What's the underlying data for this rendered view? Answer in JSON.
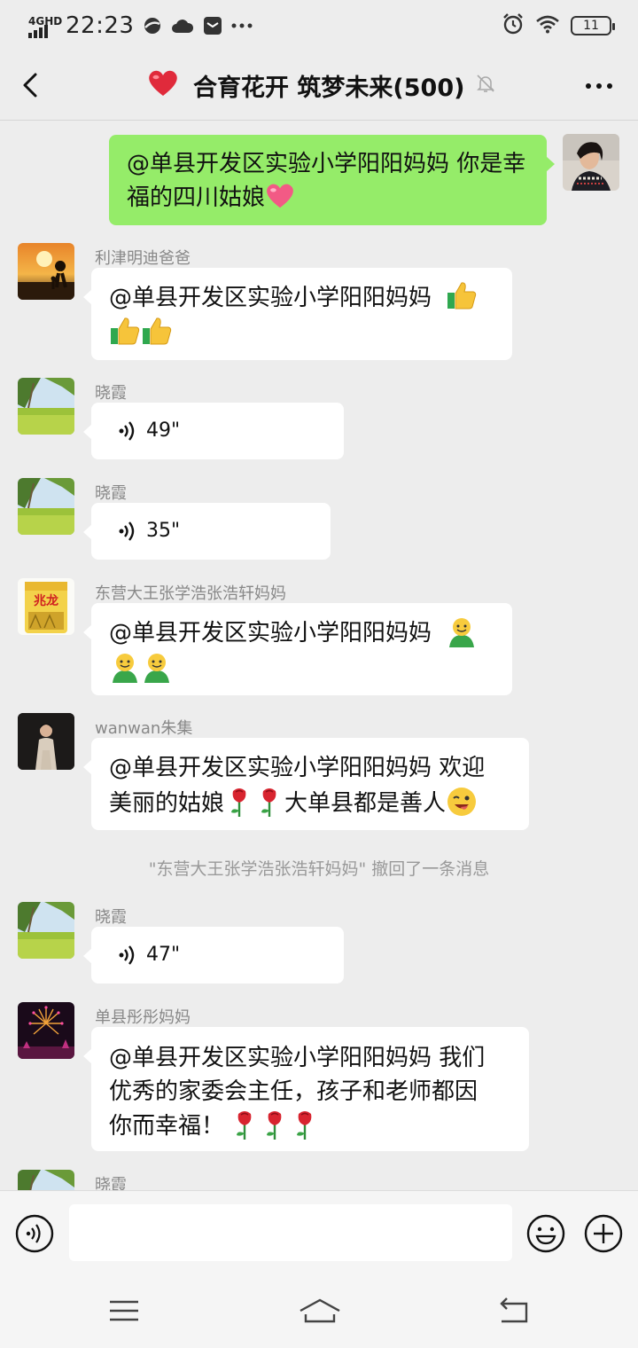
{
  "status_bar": {
    "network": "4GHD",
    "time": "22:23",
    "battery": "11"
  },
  "header": {
    "title": "合育花开 筑梦未来(500)"
  },
  "messages": [
    {
      "sender": "me",
      "text": "@单县开发区实验小学阳阳妈妈  你是幸福的四川姑娘"
    },
    {
      "sender": "利津明迪爸爸",
      "text": "@单县开发区实验小学阳阳妈妈"
    },
    {
      "sender": "晓霞",
      "duration": "49\""
    },
    {
      "sender": "晓霞",
      "duration": "35\""
    },
    {
      "sender": "东营大王张学浩张浩轩妈妈",
      "text": "@单县开发区实验小学阳阳妈妈"
    },
    {
      "sender": "wanwan朱集",
      "text_a": "@单县开发区实验小学阳阳妈妈  欢迎",
      "text_b": "美丽的姑娘",
      "text_c": "大单县都是善人"
    },
    {
      "system": "\"东营大王张学浩张浩轩妈妈\" 撤回了一条消息"
    },
    {
      "sender": "晓霞",
      "duration": "47\""
    },
    {
      "sender": "单县彤彤妈妈",
      "text_a": "@单县开发区实验小学阳阳妈妈  我们",
      "text_b": "优秀的家委会主任，孩子和老师都因",
      "text_c": "你而幸福！"
    },
    {
      "sender": "晓霞"
    }
  ],
  "avatar_text": {
    "rice_bag": "兆龙"
  },
  "input": {
    "placeholder": ""
  },
  "colors": {
    "my_bubble": "#95ec69",
    "background": "#ededed",
    "heart": "#e02a3b"
  }
}
